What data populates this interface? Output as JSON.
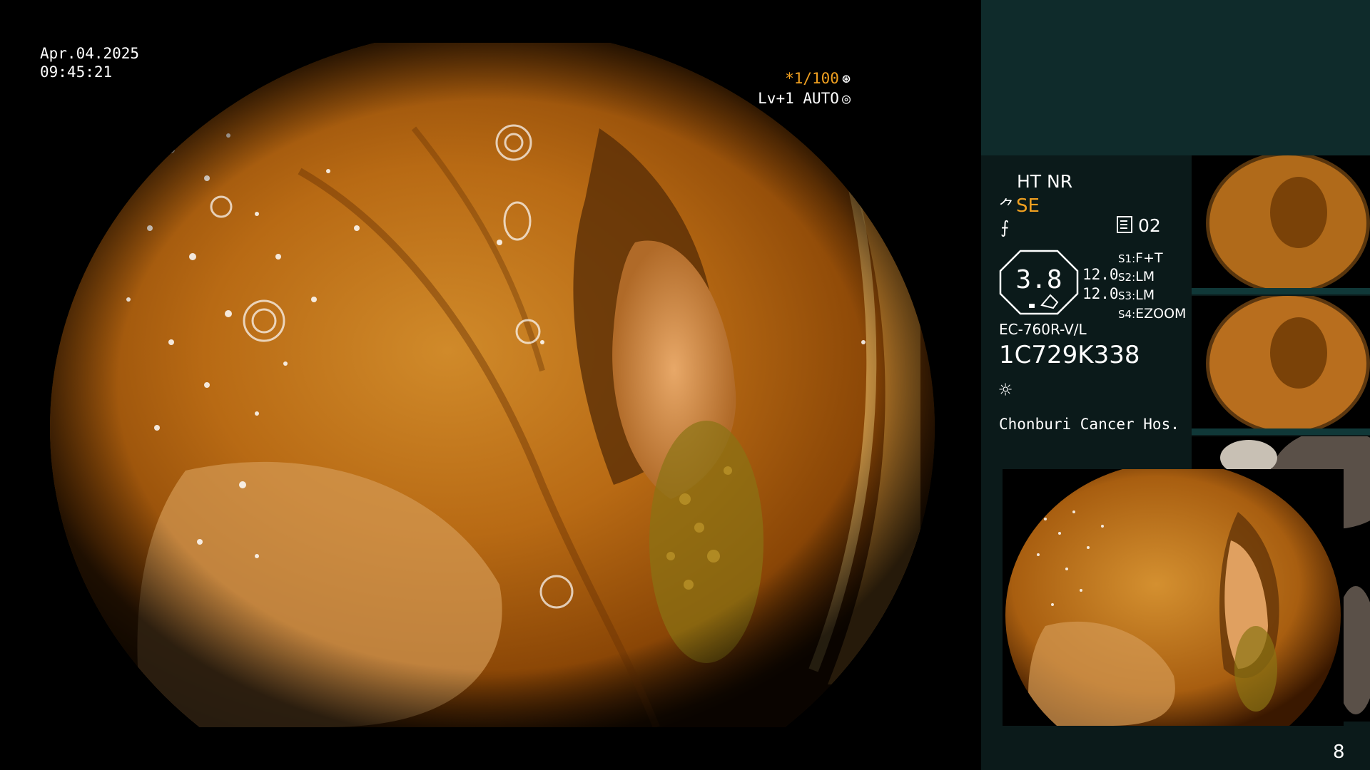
{
  "overlay": {
    "date": "Apr.04.2025",
    "time": "09:45:21",
    "shutter": "*1/100",
    "level": "Lv+1 AUTO"
  },
  "panel": {
    "mode": "HT NR",
    "enhance": "SE",
    "capture_count": "02",
    "zoom_value": "3.8",
    "values": [
      "12.0",
      "12.0"
    ],
    "s_keys": [
      "S1:",
      "S2:",
      "S3:",
      "S4:"
    ],
    "s_values": [
      "F+T",
      "LM",
      "LM",
      "EZOOM"
    ],
    "scope_model": "EC-760R-V/L",
    "serial": "1C729K338",
    "hospital": "Chonburi Cancer Hos.",
    "page_number": "8"
  },
  "colors": {
    "panel_bg": "#0b1a1a",
    "panel_top": "#0f2b2b",
    "accent": "#f0a020"
  },
  "icons": [
    "lens-icon",
    "aperture-icon",
    "scope-icon",
    "function-icon",
    "memo-icon",
    "brightness-icon"
  ]
}
